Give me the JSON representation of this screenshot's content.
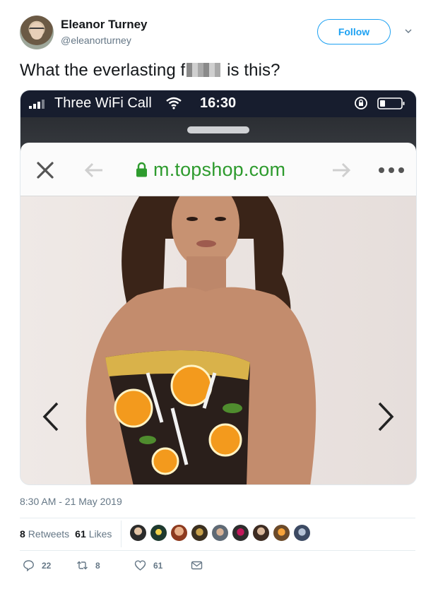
{
  "tweet": {
    "user": {
      "name": "Eleanor Turney",
      "handle": "@eleanorturney",
      "follow_label": "Follow"
    },
    "text": {
      "before": "What the everlasting f",
      "after": " is this?"
    },
    "screenshot": {
      "carrier": "Three WiFi Call",
      "time": "16:30",
      "url": "m.topshop.com"
    },
    "timestamp": "8:30 AM - 21 May 2019",
    "stats": {
      "retweets_count": "8",
      "retweets_label": "Retweets",
      "likes_count": "61",
      "likes_label": "Likes"
    },
    "actions": {
      "replies": "22",
      "retweets": "8",
      "likes": "61"
    }
  },
  "colors": {
    "accent": "#1da1f2",
    "muted": "#657786",
    "url_green": "#2e9b2e",
    "status_bar": "#171d2e"
  }
}
